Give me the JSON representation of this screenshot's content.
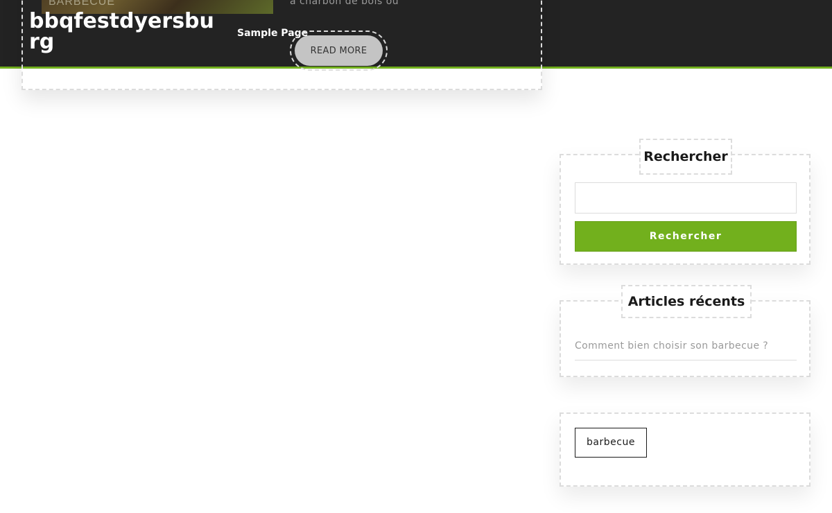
{
  "site": {
    "title": "bbqfestdyersburg"
  },
  "nav": {
    "sample_page": "Sample Page"
  },
  "post": {
    "thumbnail_label": "BARBECUE",
    "excerpt_fragment": "à charbon de bois ou",
    "read_more": "READ MORE"
  },
  "sidebar": {
    "search": {
      "title": "Rechercher",
      "input_value": "",
      "button_label": "Rechercher"
    },
    "recent": {
      "title": "Articles récents",
      "items": [
        {
          "label": "Comment bien choisir son barbecue ?"
        }
      ]
    },
    "tags": {
      "items": [
        {
          "label": "barbecue"
        }
      ]
    }
  },
  "colors": {
    "header_bg": "#232323",
    "accent_green": "#72b01d",
    "read_more_bg": "#c4c4c4"
  }
}
